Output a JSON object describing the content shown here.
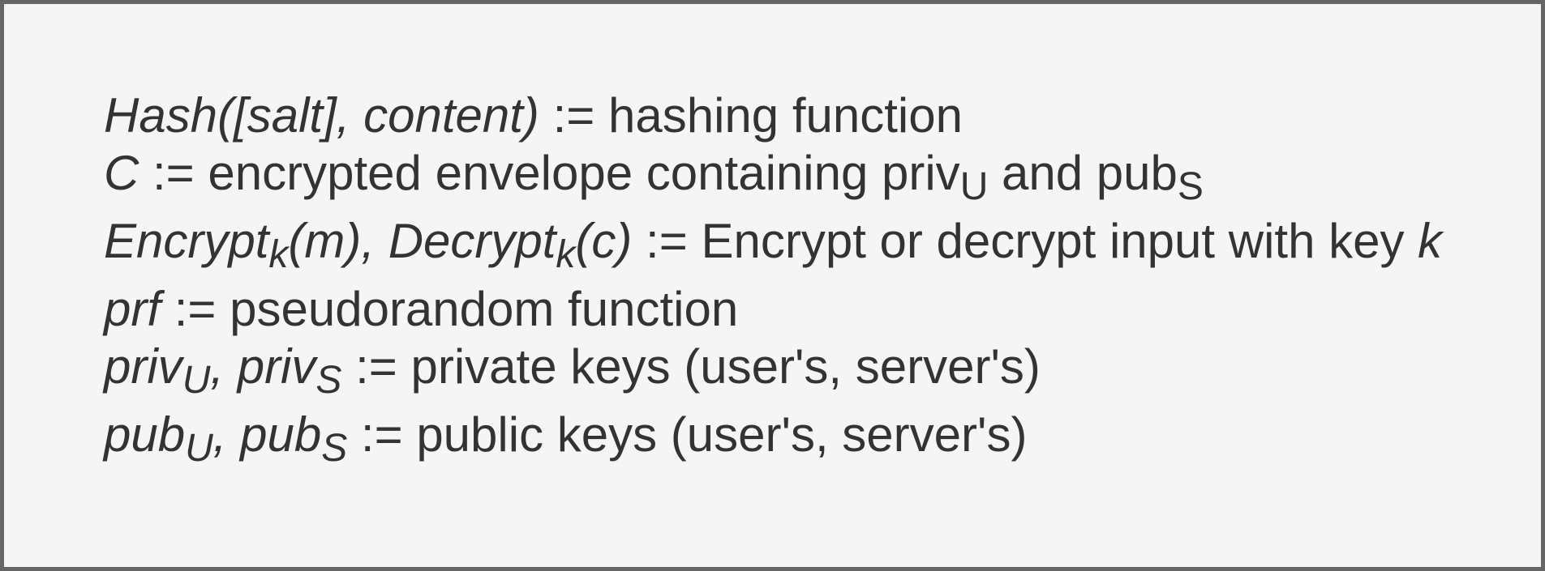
{
  "definitions": [
    {
      "term_a": "Hash([salt], content)",
      "sep": " := ",
      "desc": "hashing function"
    },
    {
      "term_a": "C",
      "sep": " := ",
      "desc_a": "encrypted envelope containing priv",
      "sub_a": "U",
      "desc_b": " and pub",
      "sub_b": "S"
    },
    {
      "term_a": "Encrypt",
      "sub_a": "k",
      "term_b": "(m), Decrypt",
      "sub_b": "k",
      "term_c": "(c)",
      "sep": " := ",
      "desc": "Encrypt or decrypt input with key ",
      "desc_var": "k"
    },
    {
      "term_a": "prf",
      "sep": " := ",
      "desc": "pseudorandom function"
    },
    {
      "term_a": "priv",
      "sub_a": "U",
      "term_b": ", priv",
      "sub_b": "S",
      "sep": " := ",
      "desc": "private keys (user's, server's)"
    },
    {
      "term_a": "pub",
      "sub_a": "U",
      "term_b": ", pub",
      "sub_b": "S",
      "sep": " := ",
      "desc": "public keys (user's, server's)"
    }
  ],
  "colors": {
    "background": "#f5f5f5",
    "border": "#666666",
    "text": "#333333"
  }
}
